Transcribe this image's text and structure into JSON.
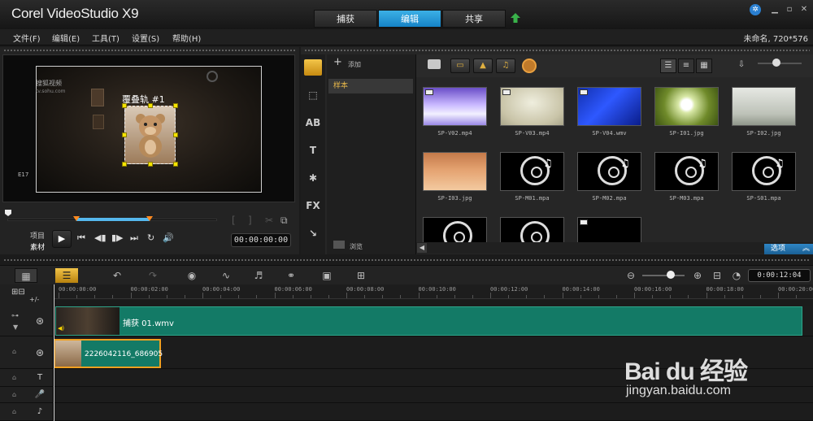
{
  "app": {
    "title": "Corel VideoStudio X9"
  },
  "mode_tabs": [
    {
      "label": "捕获",
      "active": false
    },
    {
      "label": "编辑",
      "active": true
    },
    {
      "label": "共享",
      "active": false
    }
  ],
  "menu": [
    {
      "label": "文件(F)"
    },
    {
      "label": "编辑(E)"
    },
    {
      "label": "工具(T)"
    },
    {
      "label": "设置(S)"
    },
    {
      "label": "帮助(H)"
    }
  ],
  "project_info": "未命名, 720*576",
  "player": {
    "overlay_label": "覆叠轨 #1",
    "watermark_logo": "搜狐视频",
    "watermark_url": "tv.sohu.com",
    "corner_mark": "E17",
    "mode_project": "项目",
    "mode_clip": "素材",
    "timecode": "00:00:00:00"
  },
  "library": {
    "add_label": "添加",
    "folder": "样本",
    "browse_label": "浏览",
    "options_label": "选项",
    "items": [
      {
        "name": "SP-V02.mp4",
        "kind": "video",
        "art": "purple"
      },
      {
        "name": "SP-V03.mp4",
        "kind": "video",
        "art": "beige"
      },
      {
        "name": "SP-V04.wmv",
        "kind": "video",
        "art": "blue"
      },
      {
        "name": "SP-I01.jpg",
        "kind": "image",
        "art": "dandelion"
      },
      {
        "name": "SP-I02.jpg",
        "kind": "image",
        "art": "tree"
      },
      {
        "name": "SP-I03.jpg",
        "kind": "image",
        "art": "desert"
      },
      {
        "name": "SP-M01.mpa",
        "kind": "audio",
        "art": "disc"
      },
      {
        "name": "SP-M02.mpa",
        "kind": "audio",
        "art": "disc"
      },
      {
        "name": "SP-M03.mpa",
        "kind": "audio",
        "art": "disc"
      },
      {
        "name": "SP-S01.mpa",
        "kind": "audio",
        "art": "disc"
      }
    ]
  },
  "timeline": {
    "duration": "0:00:12:04",
    "ruler": [
      "00:00:00:00",
      "00:00:02:00",
      "00:00:04:00",
      "00:00:06:00",
      "00:00:08:00",
      "00:00:10:00",
      "00:00:12:00",
      "00:00:14:00",
      "00:00:16:00",
      "00:00:18:00",
      "00:00:20:00"
    ],
    "video_clip": "捕获 01.wmv",
    "overlay_clip": "2226042116_686905"
  },
  "watermark": {
    "brand": "Bai du 经验",
    "url": "jingyan.baidu.com"
  },
  "colors": {
    "accent": "#1583c7",
    "track_clip": "#137a66",
    "selection": "#f0a020",
    "handle": "#f5e400"
  }
}
